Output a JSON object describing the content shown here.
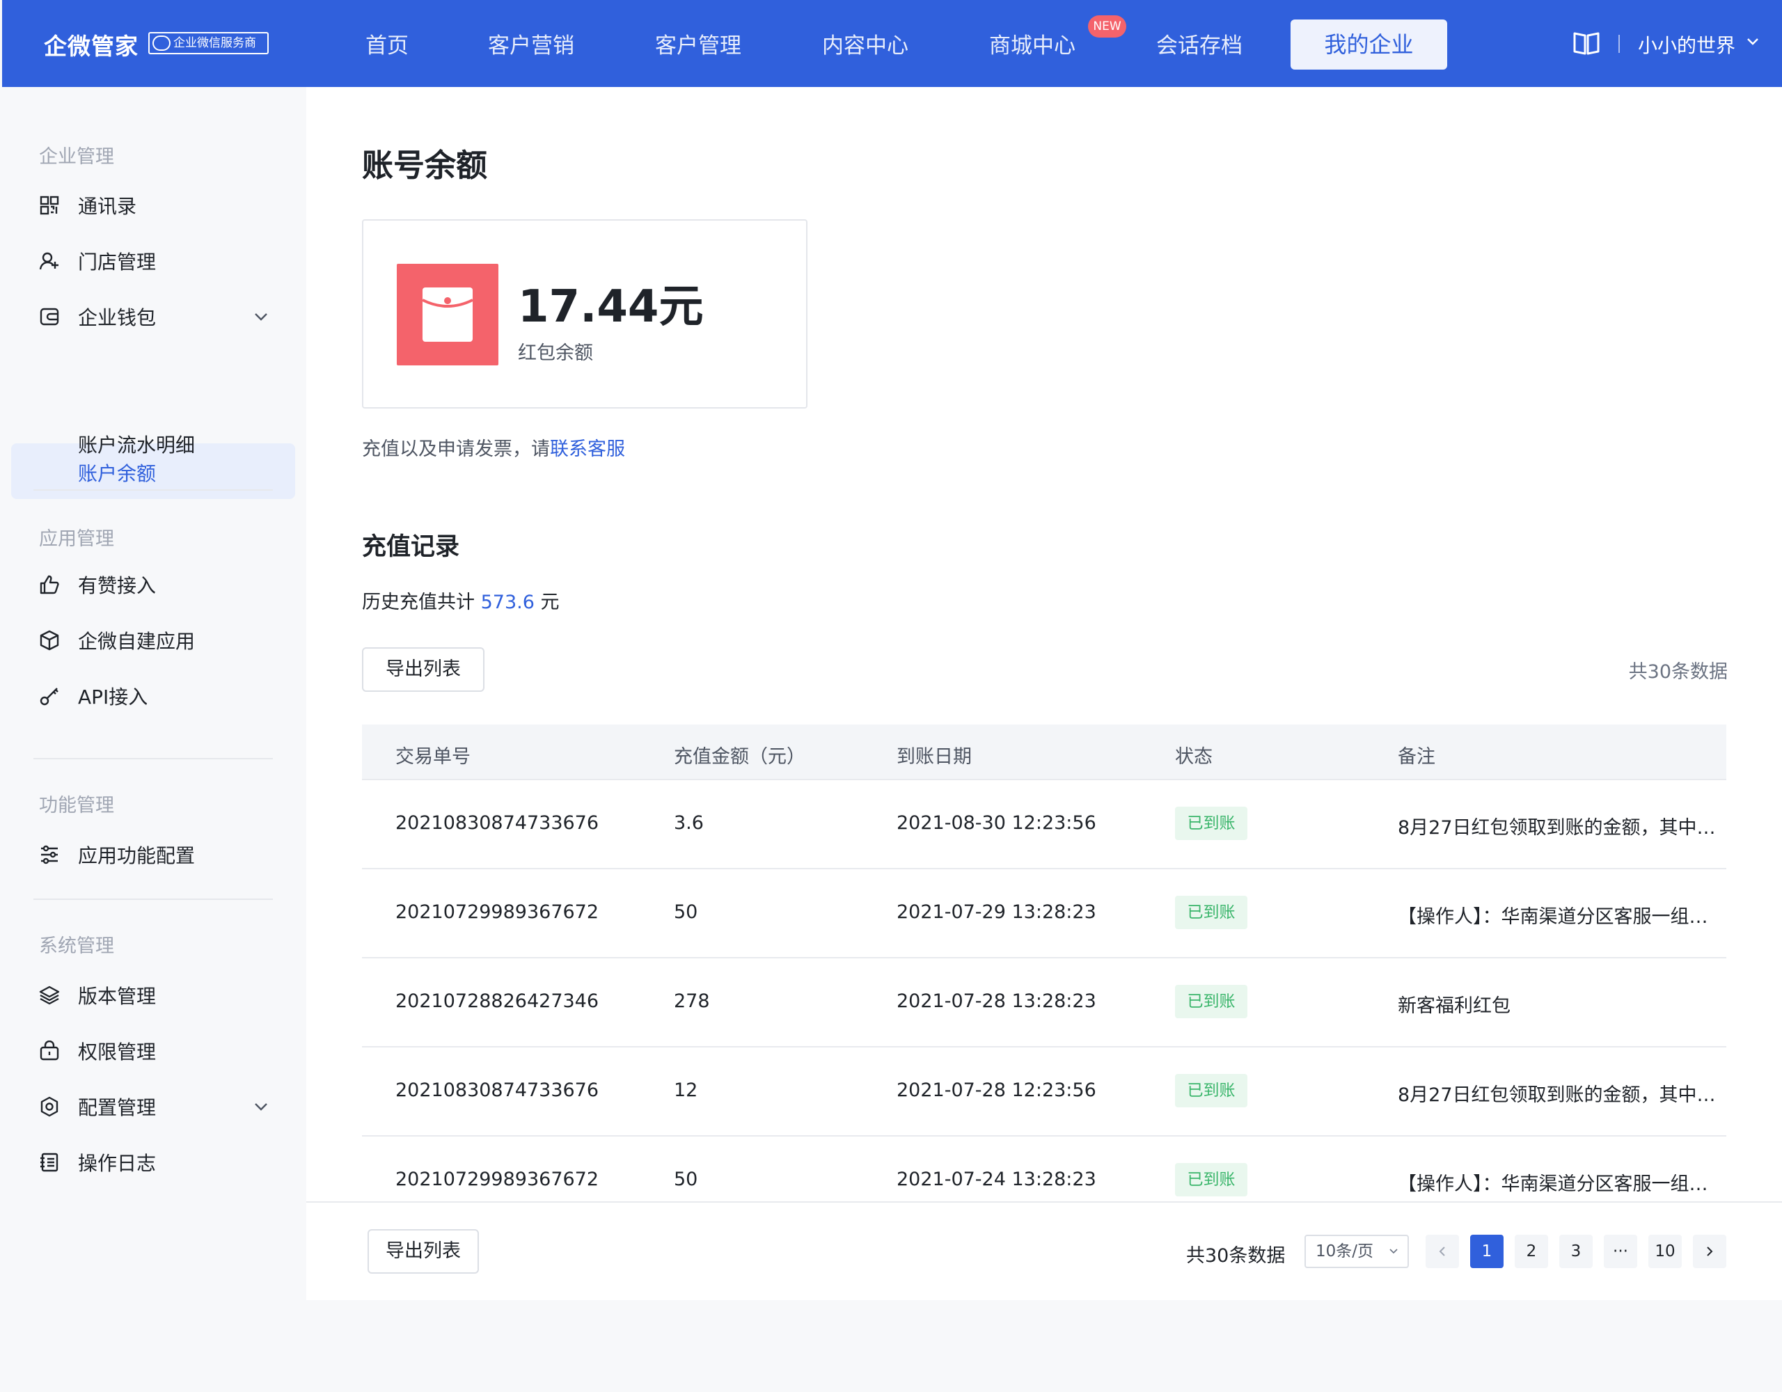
{
  "header": {
    "logo": "企微管家",
    "badge": "企业微信服务商",
    "nav": [
      "首页",
      "客户营销",
      "客户管理",
      "内容中心",
      "商城中心",
      "会话存档"
    ],
    "new_badge": "NEW",
    "active_nav": "我的企业",
    "username": "小小的世界"
  },
  "sidebar": {
    "group1": "企业管理",
    "contacts": "通讯录",
    "stores": "门店管理",
    "wallet": "企业钱包",
    "balance": "账户余额",
    "flow": "账户流水明细",
    "group2": "应用管理",
    "youzan": "有赞接入",
    "selfapp": "企微自建应用",
    "api": "API接入",
    "group3": "功能管理",
    "funcconfig": "应用功能配置",
    "group4": "系统管理",
    "version": "版本管理",
    "permission": "权限管理",
    "config": "配置管理",
    "log": "操作日志"
  },
  "main": {
    "title": "账号余额",
    "balance_amount": "17.44元",
    "balance_label": "红包余额",
    "contact_prefix": "充值以及申请发票，请",
    "contact_link": "联系客服",
    "section_title": "充值记录",
    "hist_prefix": "历史充值共计 ",
    "hist_value": "573.6",
    "hist_suffix": " 元",
    "export": "导出列表",
    "total": "共30条数据"
  },
  "table": {
    "headers": [
      "交易单号",
      "充值金额（元）",
      "到账日期",
      "状态",
      "备注"
    ],
    "rows": [
      {
        "id": "20210830874733676",
        "amount": "3.6",
        "date": "2021-08-30 12:23:56",
        "status": "已到账",
        "note": "8月27日红包领取到账的金额，其中…"
      },
      {
        "id": "20210729989367672",
        "amount": "50",
        "date": "2021-07-29 13:28:23",
        "status": "已到账",
        "note": "【操作人】：华南渠道分区客服一组…"
      },
      {
        "id": "20210728826427346",
        "amount": "278",
        "date": "2021-07-28 13:28:23",
        "status": "已到账",
        "note": "新客福利红包"
      },
      {
        "id": "20210830874733676",
        "amount": "12",
        "date": "2021-07-28 12:23:56",
        "status": "已到账",
        "note": "8月27日红包领取到账的金额，其中…"
      },
      {
        "id": "20210729989367672",
        "amount": "50",
        "date": "2021-07-24 13:28:23",
        "status": "已到账",
        "note": "【操作人】：华南渠道分区客服一组…"
      }
    ]
  },
  "pagination": {
    "export": "导出列表",
    "total": "共30条数据",
    "page_size": "10条/页",
    "pages": [
      "1",
      "2",
      "3",
      "···",
      "10"
    ]
  }
}
